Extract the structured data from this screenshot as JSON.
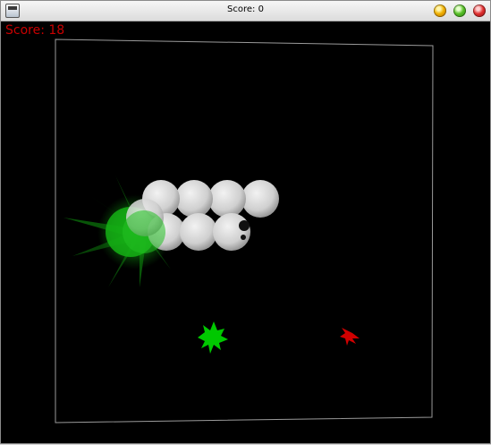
{
  "window": {
    "title": "Score: 0",
    "icon": "app-window-icon",
    "buttons": [
      "minimize-icon",
      "maximize-icon",
      "close-icon"
    ]
  },
  "hud": {
    "score_text": "Score: 18"
  },
  "colors": {
    "background": "#000000",
    "score": "#c80000",
    "arena_border": "#9a9a9a",
    "snake_ball": "#d3d3d3",
    "flame": "#00b400",
    "enemy": "#00d000",
    "food": "#d00000"
  }
}
